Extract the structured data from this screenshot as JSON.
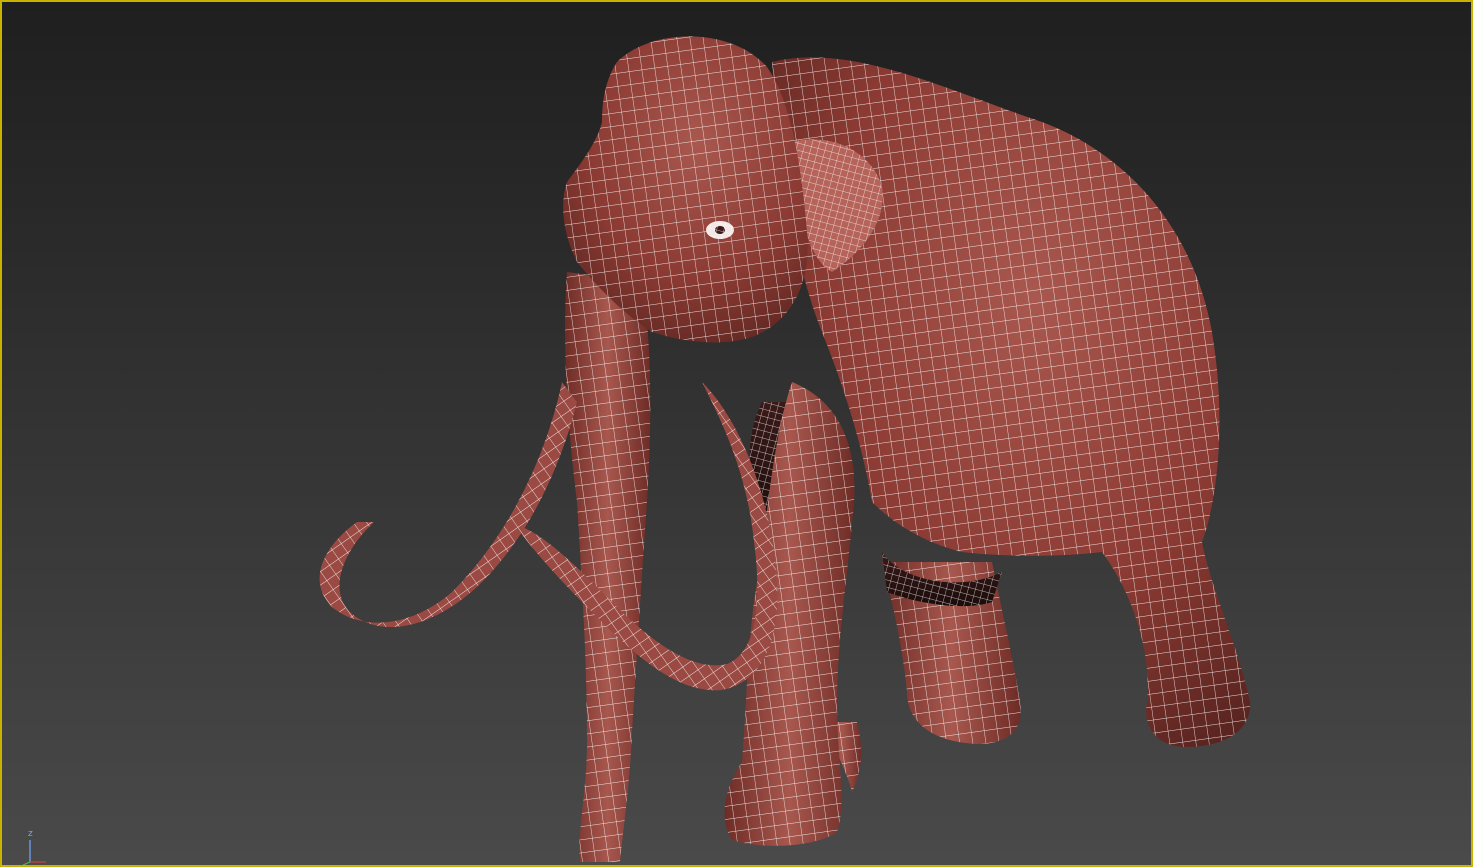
{
  "viewport": {
    "active": true,
    "border_color": "#c8b400",
    "background_top": "#1f1f1f",
    "background_bottom": "#4a4a4a",
    "shading_mode": "edged-faces"
  },
  "model": {
    "subject": "mammoth",
    "surface_color": "#8a3a32",
    "wireframe_color": "#ffffff"
  },
  "axis_gizmo": {
    "z_label": "z",
    "z_color": "#6fa8ff",
    "x_color": "#d04040",
    "y_color": "#40c040"
  }
}
